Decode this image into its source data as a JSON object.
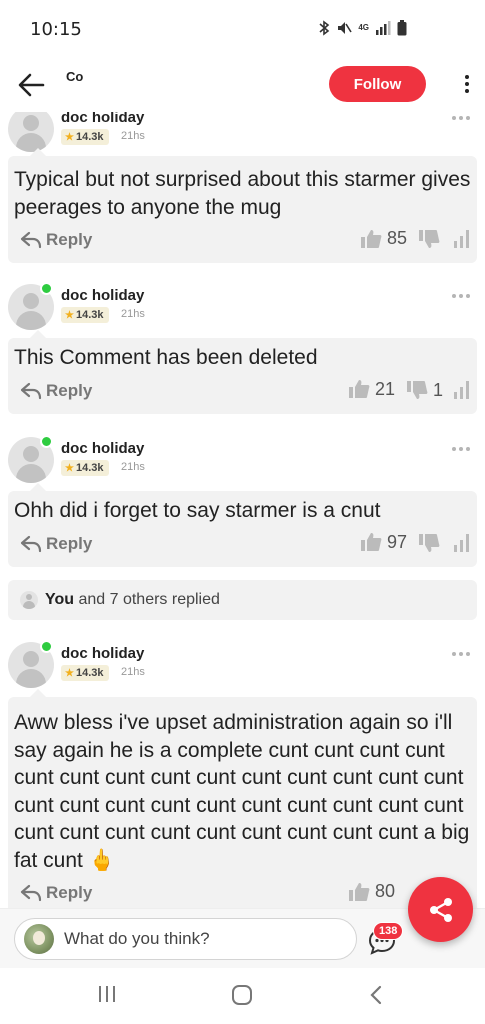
{
  "status_bar": {
    "time": "10:15",
    "icons": [
      "bluetooth-icon",
      "mute-icon",
      "4g-icon",
      "signal-icon",
      "battery-icon"
    ],
    "network_label": "4G"
  },
  "header": {
    "title": "Co",
    "follow_label": "Follow",
    "accent_color": "#ef3340"
  },
  "comments": [
    {
      "author": "doc holiday",
      "score": "14.3k",
      "time": "21hs",
      "text": "Typical but not surprised about this starmer gives peerages to anyone the mug",
      "reply_label": "Reply",
      "likes": "85",
      "dislikes": ""
    },
    {
      "author": "doc holiday",
      "score": "14.3k",
      "time": "21hs",
      "text": "This Comment has been deleted",
      "reply_label": "Reply",
      "likes": "21",
      "dislikes": "1"
    },
    {
      "author": "doc holiday",
      "score": "14.3k",
      "time": "21hs",
      "text": "Ohh did i forget to say starmer is a cnut",
      "reply_label": "Reply",
      "likes": "97",
      "dislikes": ""
    },
    {
      "author": "doc holiday",
      "score": "14.3k",
      "time": "21hs",
      "text": "Aww bless i've upset administration again so i'll say again he is a complete cunt cunt cunt cunt cunt cunt cunt cunt cunt cunt cunt cunt cunt cunt cunt cunt cunt cunt cunt cunt cunt cunt cunt cunt cunt cunt cunt cunt cunt cunt cunt cunt cunt a big fat cunt 🖕",
      "reply_label": "Reply",
      "likes": "80",
      "dislikes": ""
    }
  ],
  "replies_summary": {
    "you": "You",
    "rest": " and 7 others replied"
  },
  "bottom_bar": {
    "input_placeholder": "What do you think?",
    "comments_count": "138"
  }
}
